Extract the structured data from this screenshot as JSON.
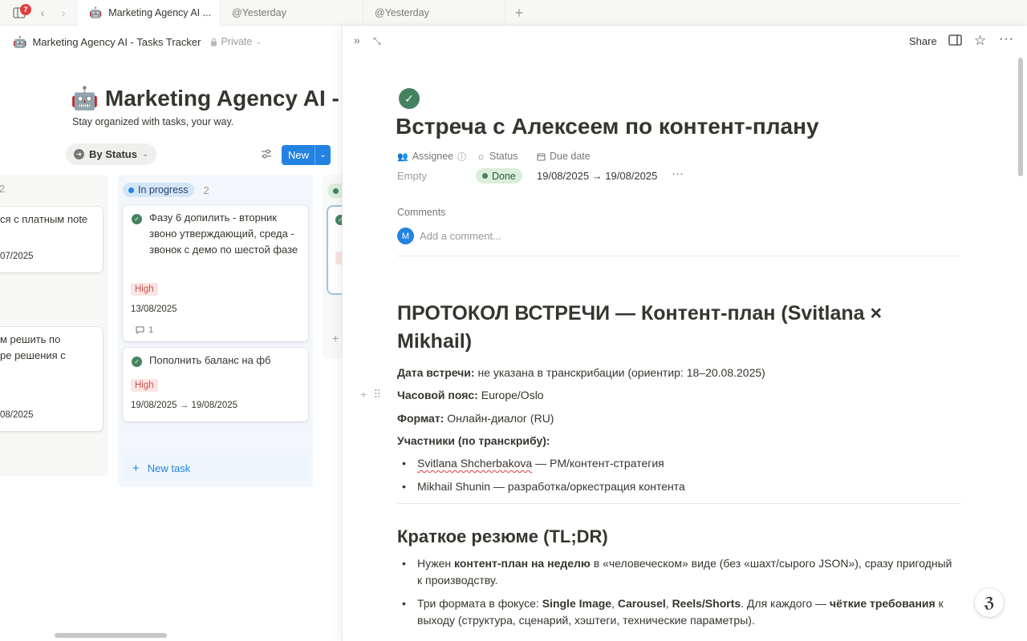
{
  "tabbar": {
    "badge_count": "7",
    "tabs": [
      {
        "emoji": "🤖",
        "label": "Marketing Agency AI ..."
      },
      {
        "label": "@Yesterday"
      },
      {
        "label": "@Yesterday"
      }
    ],
    "add_tab": "+"
  },
  "board": {
    "breadcrumb": {
      "emoji": "🤖",
      "title": "Marketing Agency AI - Tasks Tracker",
      "privacy": "Private"
    },
    "page_title": "Marketing Agency AI -",
    "page_emoji": "🤖",
    "subtitle": "Stay organized with tasks, your way.",
    "view_label": "By Status",
    "new_label": "New",
    "columns": [
      {
        "count": "2",
        "cards": [
          {
            "title": "ся с платным note",
            "date": "07/2025"
          },
          {
            "title_line1": "м решить по",
            "title_line2": "ре решения с",
            "date": "08/2025"
          }
        ]
      },
      {
        "label": "In progress",
        "count": "2",
        "color": "#2383e2",
        "cards": [
          {
            "title": "Фазу 6 допилить - вторник звоно утверждающий, среда - звонок с демо по шестой фазе",
            "priority": "High",
            "date": "13/08/2025",
            "comments": "1"
          },
          {
            "title": "Пополнить баланс на фб",
            "priority": "High",
            "date": "19/08/2025 → 19/08/2025"
          }
        ],
        "new_task": "New task"
      }
    ]
  },
  "peek": {
    "share": "Share",
    "title": "Встреча с Алексеем по контент-плану",
    "props": {
      "assignee_label": "Assignee",
      "assignee_value": "Empty",
      "status_label": "Status",
      "status_value": "Done",
      "due_label": "Due date",
      "due_value": "19/08/2025 → 19/08/2025"
    },
    "comments_label": "Comments",
    "avatar_initial": "M",
    "comment_placeholder": "Add a comment...",
    "doc": {
      "h1": "ПРОТОКОЛ ВСТРЕЧИ — Контент-план (Svitlana × Mikhail)",
      "date_label": "Дата встречи:",
      "date_value": " не указана в транскрибации (ориентир: 18–20.08.2025)",
      "tz_label": "Часовой пояс:",
      "tz_value": " Europe/Oslo",
      "format_label": "Формат:",
      "format_value": " Онлайн-диалог (RU)",
      "participants_label": "Участники (по транскрибу):",
      "participant1_name": "Svitlana Shcherbakova",
      "participant1_role": " — PM/контент-стратегия",
      "participant2": "Mikhail Shunin — разработка/оркестрация контента",
      "h2": "Краткое резюме (TL;DR)",
      "b1_pre": "Нужен ",
      "b1_bold": "контент-план на неделю",
      "b1_post": " в «человеческом» виде (без «шахт/сырого JSON»), сразу пригодный к производству.",
      "b2_pre": "Три формата в фокусе: ",
      "b2_f1": "Single Image",
      "b2_sep1": ", ",
      "b2_f2": "Carousel",
      "b2_sep2": ", ",
      "b2_f3": "Reels/Shorts",
      "b2_mid": ". Для каждого — ",
      "b2_bold": "чёткие требования",
      "b2_post": " к выходу (структура, сценарий, хэштеги, технические параметры)."
    }
  }
}
